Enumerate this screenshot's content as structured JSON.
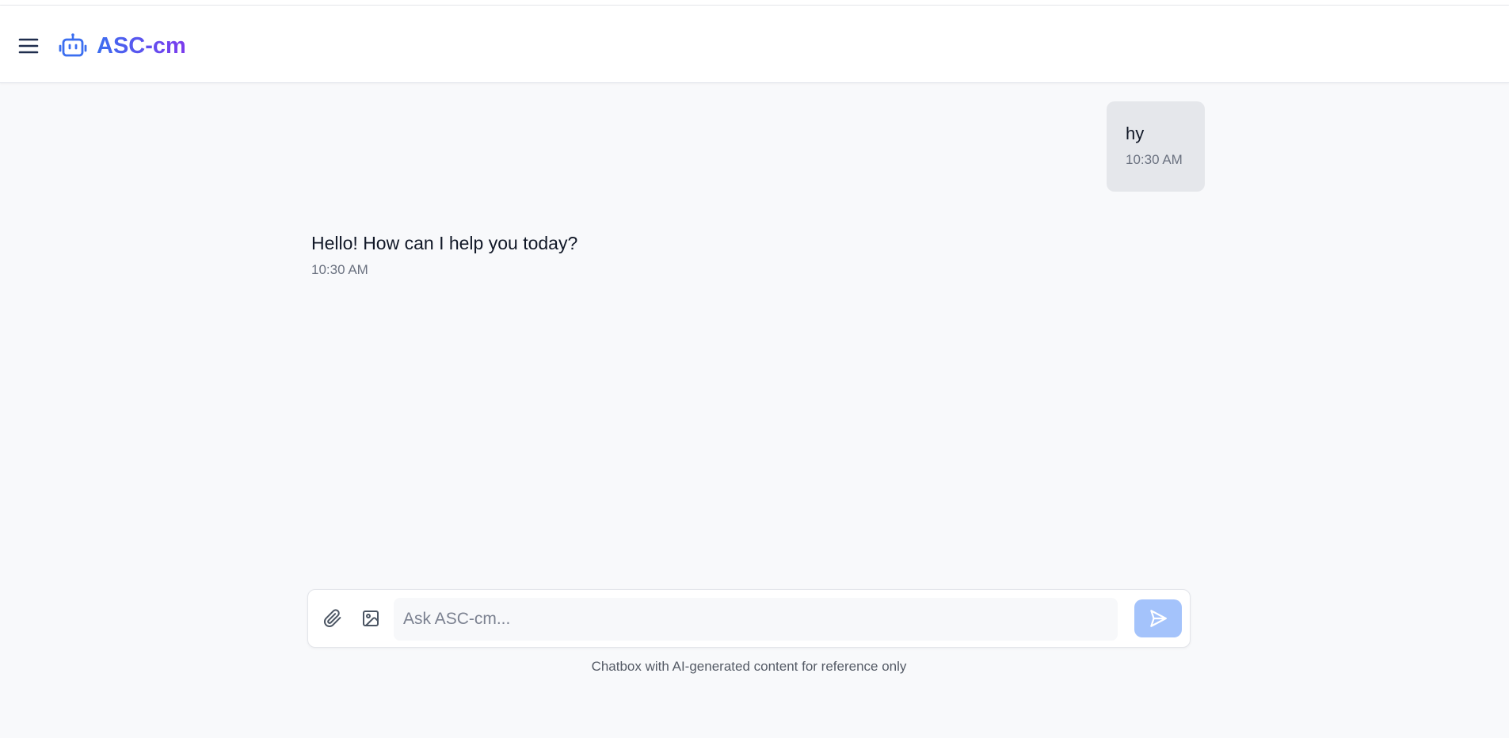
{
  "header": {
    "menu_icon": "hamburger-menu-icon",
    "logo_icon": "robot-icon",
    "brand_name": "ASC-cm",
    "brand_gradient": [
      "#3b6ef0",
      "#7c3aed"
    ]
  },
  "messages": [
    {
      "role": "user",
      "text": "hy",
      "time": "10:30 AM"
    },
    {
      "role": "assistant",
      "text": "Hello! How can I help you today?",
      "time": "10:30 AM"
    }
  ],
  "composer": {
    "attach_icon": "paperclip-icon",
    "image_icon": "image-icon",
    "placeholder": "Ask ASC-cm...",
    "value": "",
    "send_icon": "send-icon",
    "send_color": "#a4c3fb"
  },
  "footer": {
    "disclaimer": "Chatbox with AI-generated content for reference only"
  }
}
